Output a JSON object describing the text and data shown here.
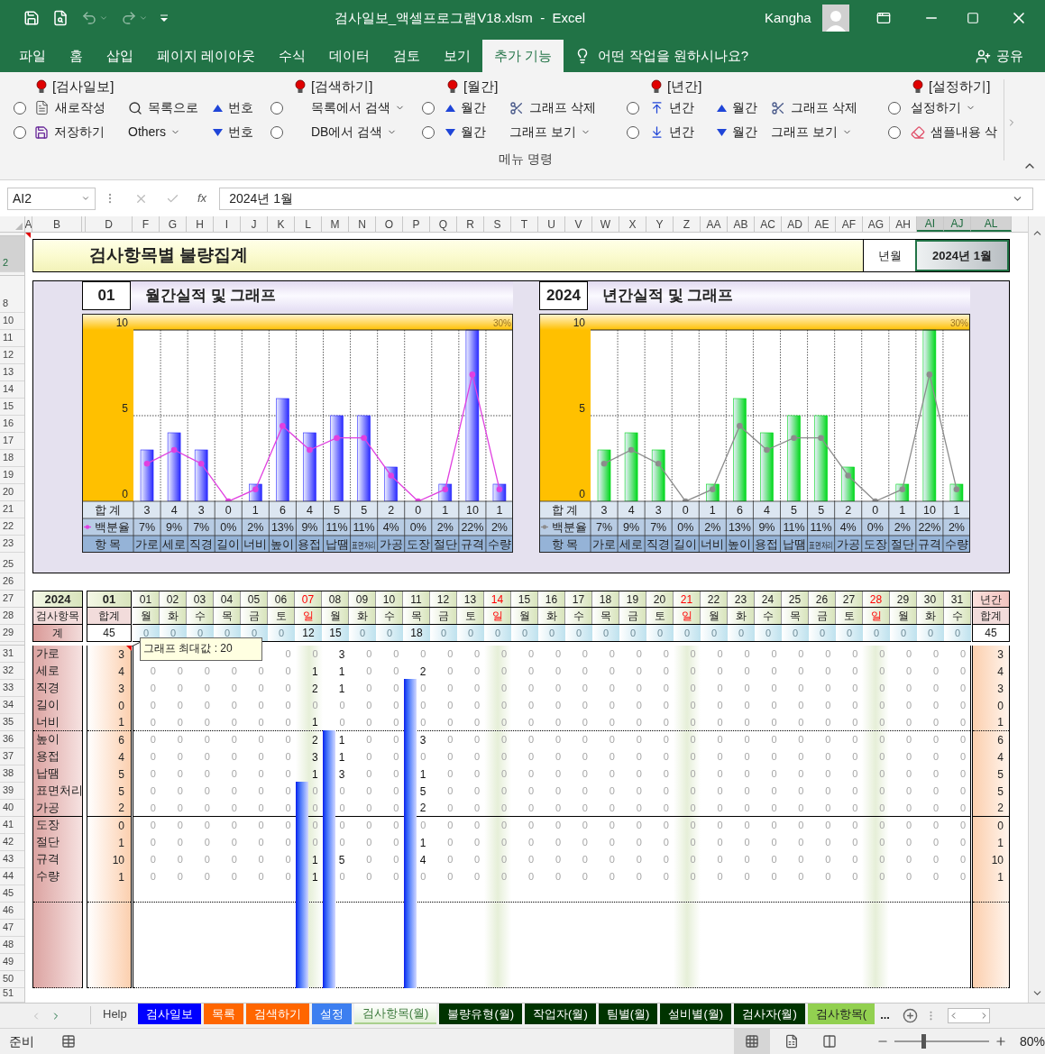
{
  "window": {
    "title": "검사일보_액셀프로그램V18.xlsm  -  Excel",
    "user": "Kangha"
  },
  "menu_tabs": [
    {
      "label": "파일",
      "selected": false
    },
    {
      "label": "홈",
      "selected": false
    },
    {
      "label": "삽입",
      "selected": false
    },
    {
      "label": "페이지 레이아웃",
      "selected": false
    },
    {
      "label": "수식",
      "selected": false
    },
    {
      "label": "데이터",
      "selected": false
    },
    {
      "label": "검토",
      "selected": false
    },
    {
      "label": "보기",
      "selected": false
    },
    {
      "label": "추가 기능",
      "selected": true
    }
  ],
  "tell_me": "어떤 작업을 원하시나요?",
  "share": "공유",
  "ribbon": {
    "headers": [
      "[검사일보]",
      "[검색하기]",
      "[월간]",
      "[년간]",
      "[설정하기]"
    ],
    "rows": [
      [
        {
          "kind": "radio",
          "checked": false
        },
        {
          "kind": "button",
          "label": "새로작성"
        },
        {
          "kind": "button",
          "label": "목록으로"
        },
        {
          "kind": "button",
          "label": "번호"
        },
        {
          "kind": "radio",
          "checked": false
        },
        {
          "kind": "dropdown",
          "label": "목록에서 검색"
        },
        {
          "kind": "radio",
          "checked": false
        },
        {
          "kind": "button",
          "label": "월간"
        },
        {
          "kind": "button",
          "label": "그래프 삭제"
        },
        {
          "kind": "radio",
          "checked": false
        },
        {
          "kind": "button",
          "label": "년간"
        },
        {
          "kind": "button",
          "label": "월간"
        },
        {
          "kind": "button",
          "label": "그래프 삭제"
        },
        {
          "kind": "radio",
          "checked": false
        },
        {
          "kind": "dropdown",
          "label": "설정하기"
        }
      ],
      [
        {
          "kind": "radio",
          "checked": false
        },
        {
          "kind": "button",
          "label": "저장하기"
        },
        {
          "kind": "dropdown",
          "label": "Others"
        },
        {
          "kind": "button",
          "label": "번호"
        },
        {
          "kind": "radio",
          "checked": false
        },
        {
          "kind": "dropdown",
          "label": "DB에서 검색"
        },
        {
          "kind": "radio",
          "checked": false
        },
        {
          "kind": "button",
          "label": "월간"
        },
        {
          "kind": "dropdown",
          "label": "그래프 보기"
        },
        {
          "kind": "radio",
          "checked": false
        },
        {
          "kind": "button",
          "label": "년간"
        },
        {
          "kind": "button",
          "label": "월간"
        },
        {
          "kind": "dropdown",
          "label": "그래프 보기"
        },
        {
          "kind": "radio",
          "checked": false
        },
        {
          "kind": "button",
          "label": "샘플내용 삭"
        }
      ]
    ],
    "group_label": "메뉴 명령"
  },
  "formula_bar": {
    "name_box": "AI2",
    "function_label": "fx",
    "value": "2024년 1월"
  },
  "columns": [
    {
      "label": "A",
      "selected": false
    },
    {
      "label": "B",
      "selected": false
    },
    {
      "label": "D",
      "selected": false
    },
    {
      "label": "F",
      "selected": false
    },
    {
      "label": "G",
      "selected": false
    },
    {
      "label": "H",
      "selected": false
    },
    {
      "label": "I",
      "selected": false
    },
    {
      "label": "J",
      "selected": false
    },
    {
      "label": "K",
      "selected": false
    },
    {
      "label": "L",
      "selected": false
    },
    {
      "label": "M",
      "selected": false
    },
    {
      "label": "N",
      "selected": false
    },
    {
      "label": "O",
      "selected": false
    },
    {
      "label": "P",
      "selected": false
    },
    {
      "label": "Q",
      "selected": false
    },
    {
      "label": "R",
      "selected": false
    },
    {
      "label": "S",
      "selected": false
    },
    {
      "label": "T",
      "selected": false
    },
    {
      "label": "U",
      "selected": false
    },
    {
      "label": "V",
      "selected": false
    },
    {
      "label": "W",
      "selected": false
    },
    {
      "label": "X",
      "selected": false
    },
    {
      "label": "Y",
      "selected": false
    },
    {
      "label": "Z",
      "selected": false
    },
    {
      "label": "AA",
      "selected": false
    },
    {
      "label": "AB",
      "selected": false
    },
    {
      "label": "AC",
      "selected": false
    },
    {
      "label": "AD",
      "selected": false
    },
    {
      "label": "AE",
      "selected": false
    },
    {
      "label": "AF",
      "selected": false
    },
    {
      "label": "AG",
      "selected": false
    },
    {
      "label": "AH",
      "selected": false
    },
    {
      "label": "AI",
      "selected": true
    },
    {
      "label": "AJ",
      "selected": true
    },
    {
      "label": "AL",
      "selected": true
    }
  ],
  "row_numbers": [
    {
      "label": "2",
      "selected": true
    },
    {
      "label": "8",
      "selected": false
    },
    {
      "label": "10",
      "selected": false
    },
    {
      "label": "11",
      "selected": false
    },
    {
      "label": "12",
      "selected": false
    },
    {
      "label": "13",
      "selected": false
    },
    {
      "label": "14",
      "selected": false
    },
    {
      "label": "15",
      "selected": false
    },
    {
      "label": "16",
      "selected": false
    },
    {
      "label": "17",
      "selected": false
    },
    {
      "label": "18",
      "selected": false
    },
    {
      "label": "19",
      "selected": false
    },
    {
      "label": "20",
      "selected": false
    },
    {
      "label": "21",
      "selected": false
    },
    {
      "label": "22",
      "selected": false
    },
    {
      "label": "23",
      "selected": false
    },
    {
      "label": "25",
      "selected": false
    },
    {
      "label": "26",
      "selected": false
    },
    {
      "label": "27",
      "selected": false
    },
    {
      "label": "28",
      "selected": false
    },
    {
      "label": "29",
      "selected": false
    },
    {
      "label": "31",
      "selected": false
    },
    {
      "label": "32",
      "selected": false
    },
    {
      "label": "33",
      "selected": false
    },
    {
      "label": "34",
      "selected": false
    },
    {
      "label": "35",
      "selected": false
    },
    {
      "label": "36",
      "selected": false
    },
    {
      "label": "37",
      "selected": false
    },
    {
      "label": "38",
      "selected": false
    },
    {
      "label": "39",
      "selected": false
    },
    {
      "label": "40",
      "selected": false
    },
    {
      "label": "41",
      "selected": false
    },
    {
      "label": "42",
      "selected": false
    },
    {
      "label": "43",
      "selected": false
    },
    {
      "label": "44",
      "selected": false
    },
    {
      "label": "45",
      "selected": false
    },
    {
      "label": "46",
      "selected": false
    },
    {
      "label": "47",
      "selected": false
    },
    {
      "label": "48",
      "selected": false
    },
    {
      "label": "49",
      "selected": false
    },
    {
      "label": "50",
      "selected": false
    },
    {
      "label": "51",
      "selected": false
    }
  ],
  "sheet": {
    "title": "검사항목별 불량집계",
    "period_label": "년월",
    "period_value": "2024년 1월",
    "charts": [
      {
        "badge": "01",
        "title": "월간실적 및 그래프",
        "category_label": "항 목",
        "totals": [
          "3",
          "4",
          "3",
          "0",
          "1",
          "6",
          "4",
          "5",
          "5",
          "2",
          "0",
          "1",
          "10",
          "1"
        ],
        "percents": [
          "7%",
          "9%",
          "7%",
          "0%",
          "2%",
          "13%",
          "9%",
          "11%",
          "11%",
          "4%",
          "0%",
          "2%",
          "22%",
          "2%"
        ],
        "chart_data": {
          "type": "bar",
          "categories": [
            "가로",
            "세로",
            "직경",
            "길이",
            "너비",
            "높이",
            "용접",
            "납땜",
            "표면처리",
            "가공",
            "도장",
            "절단",
            "규격",
            "수량"
          ],
          "ylim": [
            0,
            10
          ],
          "yticks": [
            0,
            5,
            10
          ],
          "ref_lines": [
            {
              "axis": "y",
              "value": 5
            }
          ],
          "annotations": [
            {
              "text": "30%"
            }
          ],
          "series": [
            {
              "name": "합 계",
              "color": "#2a2aff",
              "values": [
                3,
                4,
                3,
                0,
                1,
                6,
                4,
                5,
                5,
                2,
                0,
                1,
                10,
                1
              ]
            },
            {
              "name": "백분율",
              "type": "line",
              "marker": "o",
              "color": "#e040e0",
              "values": [
                2.2,
                3.0,
                2.2,
                0,
                0.7,
                4.4,
                3.0,
                3.7,
                3.7,
                1.5,
                0,
                0.7,
                7.4,
                0.7
              ]
            }
          ]
        }
      },
      {
        "badge": "2024",
        "title": "년간실적 및 그래프",
        "category_label": "항 목",
        "totals": [
          "3",
          "4",
          "3",
          "0",
          "1",
          "6",
          "4",
          "5",
          "5",
          "2",
          "0",
          "1",
          "10",
          "1"
        ],
        "percents": [
          "7%",
          "9%",
          "7%",
          "0%",
          "2%",
          "13%",
          "9%",
          "11%",
          "11%",
          "4%",
          "0%",
          "2%",
          "22%",
          "2%"
        ],
        "chart_data": {
          "type": "bar",
          "categories": [
            "가로",
            "세로",
            "직경",
            "길이",
            "너비",
            "높이",
            "용접",
            "납땜",
            "표면처리",
            "가공",
            "도장",
            "절단",
            "규격",
            "수량"
          ],
          "ylim": [
            0,
            10
          ],
          "yticks": [
            0,
            5,
            10
          ],
          "ref_lines": [
            {
              "axis": "y",
              "value": 5
            }
          ],
          "annotations": [
            {
              "text": "30%"
            }
          ],
          "series": [
            {
              "name": "합 계",
              "color": "#00d81c",
              "values": [
                3,
                4,
                3,
                0,
                1,
                6,
                4,
                5,
                5,
                2,
                0,
                1,
                10,
                1
              ]
            },
            {
              "name": "백분율",
              "type": "line",
              "marker": "o",
              "color": "#8c8c8c",
              "values": [
                2.2,
                3.0,
                2.2,
                0,
                0.7,
                4.4,
                3.0,
                3.7,
                3.7,
                1.5,
                0,
                0.7,
                7.4,
                0.7
              ]
            }
          ]
        }
      }
    ],
    "table": {
      "year": "2024",
      "month": "01",
      "item_header": "검사항목",
      "total_header": "합계",
      "annual_header": "년간",
      "annual_total_header": "합계",
      "sum_label": "계",
      "month_sum": "45",
      "annual_sum": "45",
      "comment": "그래프 최대값 : 20",
      "days": [
        {
          "day": "01",
          "dow": "월",
          "sunday": false,
          "total": "0"
        },
        {
          "day": "02",
          "dow": "화",
          "sunday": false,
          "total": "0"
        },
        {
          "day": "03",
          "dow": "수",
          "sunday": false,
          "total": "0"
        },
        {
          "day": "04",
          "dow": "목",
          "sunday": false,
          "total": "0"
        },
        {
          "day": "05",
          "dow": "금",
          "sunday": false,
          "total": "0"
        },
        {
          "day": "06",
          "dow": "토",
          "sunday": false,
          "total": "0"
        },
        {
          "day": "07",
          "dow": "일",
          "sunday": true,
          "total": "12"
        },
        {
          "day": "08",
          "dow": "월",
          "sunday": false,
          "total": "15"
        },
        {
          "day": "09",
          "dow": "화",
          "sunday": false,
          "total": "0"
        },
        {
          "day": "10",
          "dow": "수",
          "sunday": false,
          "total": "0"
        },
        {
          "day": "11",
          "dow": "목",
          "sunday": false,
          "total": "18"
        },
        {
          "day": "12",
          "dow": "금",
          "sunday": false,
          "total": "0"
        },
        {
          "day": "13",
          "dow": "토",
          "sunday": false,
          "total": "0"
        },
        {
          "day": "14",
          "dow": "일",
          "sunday": true,
          "total": "0"
        },
        {
          "day": "15",
          "dow": "월",
          "sunday": false,
          "total": "0"
        },
        {
          "day": "16",
          "dow": "화",
          "sunday": false,
          "total": "0"
        },
        {
          "day": "17",
          "dow": "수",
          "sunday": false,
          "total": "0"
        },
        {
          "day": "18",
          "dow": "목",
          "sunday": false,
          "total": "0"
        },
        {
          "day": "19",
          "dow": "금",
          "sunday": false,
          "total": "0"
        },
        {
          "day": "20",
          "dow": "토",
          "sunday": false,
          "total": "0"
        },
        {
          "day": "21",
          "dow": "일",
          "sunday": true,
          "total": "0"
        },
        {
          "day": "22",
          "dow": "월",
          "sunday": false,
          "total": "0"
        },
        {
          "day": "23",
          "dow": "화",
          "sunday": false,
          "total": "0"
        },
        {
          "day": "24",
          "dow": "수",
          "sunday": false,
          "total": "0"
        },
        {
          "day": "25",
          "dow": "목",
          "sunday": false,
          "total": "0"
        },
        {
          "day": "26",
          "dow": "금",
          "sunday": false,
          "total": "0"
        },
        {
          "day": "27",
          "dow": "토",
          "sunday": false,
          "total": "0"
        },
        {
          "day": "28",
          "dow": "일",
          "sunday": true,
          "total": "0"
        },
        {
          "day": "29",
          "dow": "월",
          "sunday": false,
          "total": "0"
        },
        {
          "day": "30",
          "dow": "화",
          "sunday": false,
          "total": "0"
        },
        {
          "day": "31",
          "dow": "수",
          "sunday": false,
          "total": "0"
        }
      ],
      "items": [
        {
          "name": "가로",
          "month": "3",
          "annual": "3",
          "days": [
            "0",
            "0",
            "3",
            "0",
            "0",
            "0",
            "0",
            "0",
            "0",
            "0",
            "0",
            "0",
            "0",
            "0",
            "0",
            "0",
            "0",
            "0",
            "0",
            "0",
            "0",
            "0",
            "0",
            "0",
            "0",
            "0"
          ]
        },
        {
          "name": "세로",
          "month": "4",
          "annual": "4",
          "days": [
            "0",
            "0",
            "0",
            "0",
            "0",
            "0",
            "1",
            "1",
            "0",
            "0",
            "2",
            "0",
            "0",
            "0",
            "0",
            "0",
            "0",
            "0",
            "0",
            "0",
            "0",
            "0",
            "0",
            "0",
            "0",
            "0",
            "0",
            "0",
            "0",
            "0",
            "0"
          ]
        },
        {
          "name": "직경",
          "month": "3",
          "annual": "3",
          "days": [
            "0",
            "0",
            "0",
            "0",
            "0",
            "0",
            "2",
            "1",
            "0",
            "0",
            "0",
            "0",
            "0",
            "0",
            "0",
            "0",
            "0",
            "0",
            "0",
            "0",
            "0",
            "0",
            "0",
            "0",
            "0",
            "0",
            "0",
            "0",
            "0",
            "0",
            "0"
          ]
        },
        {
          "name": "길이",
          "month": "0",
          "annual": "0",
          "days": [
            "0",
            "0",
            "0",
            "0",
            "0",
            "0",
            "0",
            "0",
            "0",
            "0",
            "0",
            "0",
            "0",
            "0",
            "0",
            "0",
            "0",
            "0",
            "0",
            "0",
            "0",
            "0",
            "0",
            "0",
            "0",
            "0",
            "0",
            "0",
            "0",
            "0",
            "0"
          ]
        },
        {
          "name": "너비",
          "month": "1",
          "annual": "1",
          "days": [
            "0",
            "0",
            "0",
            "0",
            "0",
            "0",
            "1",
            "0",
            "0",
            "0",
            "0",
            "0",
            "0",
            "0",
            "0",
            "0",
            "0",
            "0",
            "0",
            "0",
            "0",
            "0",
            "0",
            "0",
            "0",
            "0",
            "0",
            "0",
            "0",
            "0",
            "0"
          ]
        },
        {
          "name": "높이",
          "month": "6",
          "annual": "6",
          "days": [
            "0",
            "0",
            "0",
            "0",
            "0",
            "0",
            "2",
            "1",
            "0",
            "0",
            "3",
            "0",
            "0",
            "0",
            "0",
            "0",
            "0",
            "0",
            "0",
            "0",
            "0",
            "0",
            "0",
            "0",
            "0",
            "0",
            "0",
            "0",
            "0",
            "0",
            "0"
          ]
        },
        {
          "name": "용접",
          "month": "4",
          "annual": "4",
          "days": [
            "0",
            "0",
            "0",
            "0",
            "0",
            "0",
            "3",
            "1",
            "0",
            "0",
            "0",
            "0",
            "0",
            "0",
            "0",
            "0",
            "0",
            "0",
            "0",
            "0",
            "0",
            "0",
            "0",
            "0",
            "0",
            "0",
            "0",
            "0",
            "0",
            "0",
            "0"
          ]
        },
        {
          "name": "납땜",
          "month": "5",
          "annual": "5",
          "days": [
            "0",
            "0",
            "0",
            "0",
            "0",
            "0",
            "1",
            "3",
            "0",
            "0",
            "1",
            "0",
            "0",
            "0",
            "0",
            "0",
            "0",
            "0",
            "0",
            "0",
            "0",
            "0",
            "0",
            "0",
            "0",
            "0",
            "0",
            "0",
            "0",
            "0",
            "0"
          ]
        },
        {
          "name": "표면처리",
          "month": "5",
          "annual": "5",
          "days": [
            "0",
            "0",
            "0",
            "0",
            "0",
            "0",
            "0",
            "0",
            "0",
            "0",
            "5",
            "0",
            "0",
            "0",
            "0",
            "0",
            "0",
            "0",
            "0",
            "0",
            "0",
            "0",
            "0",
            "0",
            "0",
            "0",
            "0",
            "0",
            "0",
            "0",
            "0"
          ]
        },
        {
          "name": "가공",
          "month": "2",
          "annual": "2",
          "days": [
            "0",
            "0",
            "0",
            "0",
            "0",
            "0",
            "0",
            "0",
            "0",
            "0",
            "2",
            "0",
            "0",
            "0",
            "0",
            "0",
            "0",
            "0",
            "0",
            "0",
            "0",
            "0",
            "0",
            "0",
            "0",
            "0",
            "0",
            "0",
            "0",
            "0",
            "0"
          ]
        },
        {
          "name": "도장",
          "month": "0",
          "annual": "0",
          "days": [
            "0",
            "0",
            "0",
            "0",
            "0",
            "0",
            "0",
            "0",
            "0",
            "0",
            "0",
            "0",
            "0",
            "0",
            "0",
            "0",
            "0",
            "0",
            "0",
            "0",
            "0",
            "0",
            "0",
            "0",
            "0",
            "0",
            "0",
            "0",
            "0",
            "0",
            "0"
          ]
        },
        {
          "name": "절단",
          "month": "1",
          "annual": "1",
          "days": [
            "0",
            "0",
            "0",
            "0",
            "0",
            "0",
            "0",
            "0",
            "0",
            "0",
            "1",
            "0",
            "0",
            "0",
            "0",
            "0",
            "0",
            "0",
            "0",
            "0",
            "0",
            "0",
            "0",
            "0",
            "0",
            "0",
            "0",
            "0",
            "0",
            "0",
            "0"
          ]
        },
        {
          "name": "규격",
          "month": "10",
          "annual": "10",
          "days": [
            "0",
            "0",
            "0",
            "0",
            "0",
            "0",
            "1",
            "5",
            "0",
            "0",
            "4",
            "0",
            "0",
            "0",
            "0",
            "0",
            "0",
            "0",
            "0",
            "0",
            "0",
            "0",
            "0",
            "0",
            "0",
            "0",
            "0",
            "0",
            "0",
            "0",
            "0"
          ]
        },
        {
          "name": "수량",
          "month": "1",
          "annual": "1",
          "days": [
            "0",
            "0",
            "0",
            "0",
            "0",
            "0",
            "1",
            "0",
            "0",
            "0",
            "0",
            "0",
            "0",
            "0",
            "0",
            "0",
            "0",
            "0",
            "0",
            "0",
            "0",
            "0",
            "0",
            "0",
            "0",
            "0",
            "0",
            "0",
            "0",
            "0",
            "0"
          ]
        }
      ]
    }
  },
  "sheet_tabs": [
    {
      "label": "Help",
      "selected": false
    },
    {
      "label": "검사일보",
      "selected": false,
      "color": "#0000ff"
    },
    {
      "label": "목록",
      "selected": false,
      "color": "#ff6600"
    },
    {
      "label": "검색하기",
      "selected": false,
      "color": "#ff6600"
    },
    {
      "label": "설정",
      "selected": false,
      "color": "#3d7ff0"
    },
    {
      "label": "검사항목(월)",
      "selected": true,
      "color": "#a9d08e"
    },
    {
      "label": "불량유형(월)",
      "selected": false,
      "color": "#003300"
    },
    {
      "label": "작업자(월)",
      "selected": false,
      "color": "#003300"
    },
    {
      "label": "팀별(월)",
      "selected": false,
      "color": "#003300"
    },
    {
      "label": "설비별(월)",
      "selected": false,
      "color": "#003300"
    },
    {
      "label": "검사자(월)",
      "selected": false,
      "color": "#003300"
    },
    {
      "label": "검사항목(",
      "selected": false,
      "color": "#92d050"
    }
  ],
  "more_tabs": "...",
  "status": {
    "text": "준비",
    "zoom": "80%",
    "level": 0.3
  }
}
